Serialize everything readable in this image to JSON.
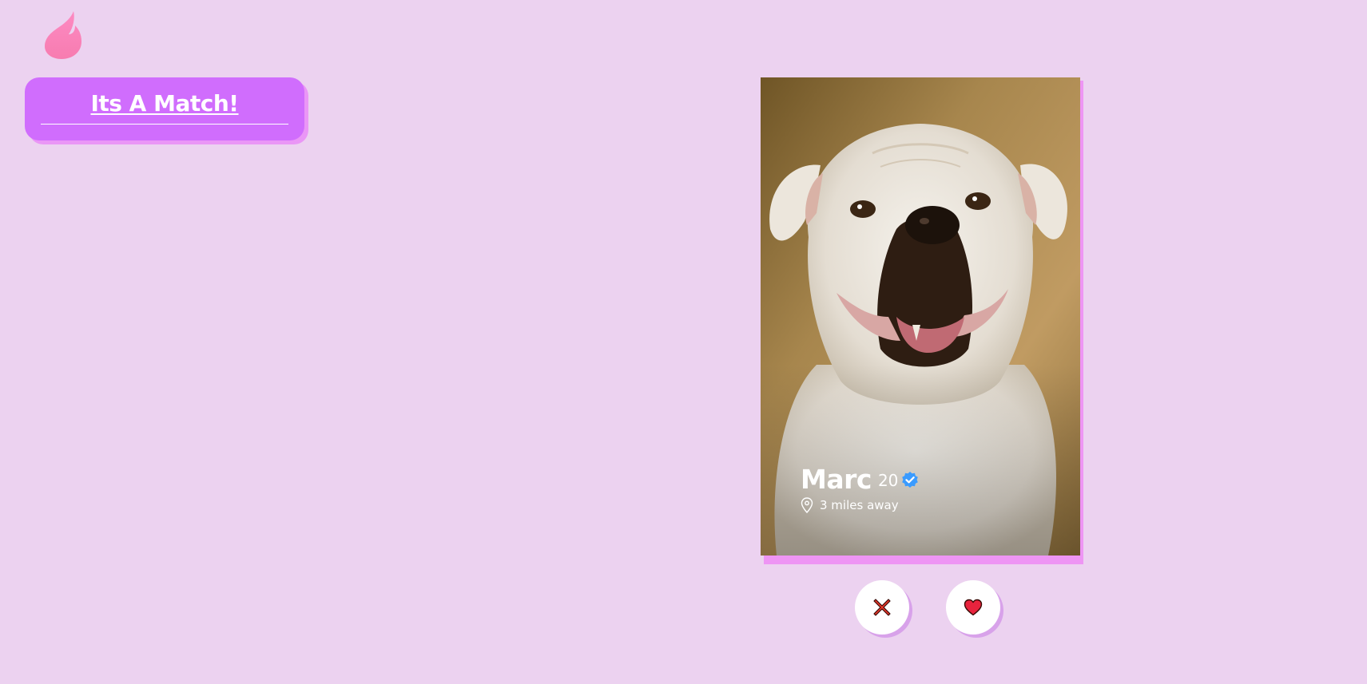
{
  "app": {
    "logo_icon": "flame-icon",
    "background_color": "#ecd2f0"
  },
  "match_button": {
    "label": "Its A Match!",
    "color": "#d06dfd",
    "shadow_color": "#ea96f6"
  },
  "profile": {
    "name": "Marc",
    "age": "20",
    "verified": true,
    "verified_icon": "verified-badge-icon",
    "location_icon": "map-pin-icon",
    "distance": "3 miles away",
    "photo_subject": "white bulldog",
    "card_shadow_color": "#ee95f4"
  },
  "actions": {
    "nope_icon": "cross-icon",
    "like_icon": "heart-icon",
    "nope_color": "#e8382b",
    "like_color": "#e8233d"
  }
}
